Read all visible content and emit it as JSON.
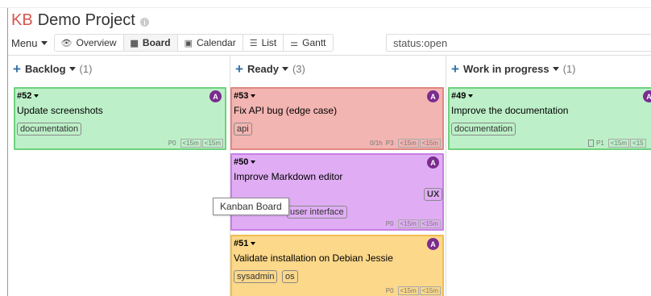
{
  "header": {
    "logo": "KB",
    "project_title": "Demo Project"
  },
  "toolbar": {
    "menu_label": "Menu",
    "views": [
      {
        "label": "Overview",
        "icon": "eye-icon",
        "glyph": "👁"
      },
      {
        "label": "Board",
        "icon": "board-icon",
        "glyph": "▦"
      },
      {
        "label": "Calendar",
        "icon": "calendar-icon",
        "glyph": "▣"
      },
      {
        "label": "List",
        "icon": "list-icon",
        "glyph": "☰"
      },
      {
        "label": "Gantt",
        "icon": "gantt-icon",
        "glyph": "⚌"
      }
    ],
    "active_view": "Board"
  },
  "search": {
    "value": "status:open"
  },
  "columns": [
    {
      "title": "Backlog",
      "count": "(1)",
      "tasks": [
        {
          "id": "#52",
          "title": "Update screenshots",
          "tags": [
            "documentation"
          ],
          "avatar": "A",
          "color": "#bdf0c8",
          "border": "#6fd17e",
          "footer": {
            "time": "",
            "priority": "P0",
            "estimates": [
              "<15m",
              "<15m"
            ]
          }
        }
      ]
    },
    {
      "title": "Ready",
      "count": "(3)",
      "tasks": [
        {
          "id": "#53",
          "title": "Fix API bug (edge case)",
          "tags": [
            "api"
          ],
          "avatar": "A",
          "color": "#f2b5b1",
          "border": "#e08882",
          "footer": {
            "time": "0/1h",
            "priority": "P3",
            "estimates": [
              "<15m",
              "<15m"
            ]
          }
        },
        {
          "id": "#50",
          "title": "Improve Markdown editor",
          "tags": [
            "UX",
            "user interface"
          ],
          "avatar": "A",
          "color": "#e0adf4",
          "border": "#c77ee6",
          "footer": {
            "time": "",
            "priority": "P0",
            "estimates": [
              "<15m",
              "<15m"
            ]
          }
        },
        {
          "id": "#51",
          "title": "Validate installation on Debian Jessie",
          "tags": [
            "sysadmin",
            "os"
          ],
          "avatar": "A",
          "color": "#fbd88a",
          "border": "#f0bd50",
          "footer": {
            "time": "",
            "priority": "P0",
            "estimates": [
              "<15m",
              "<15m"
            ]
          }
        }
      ]
    },
    {
      "title": "Work in progress",
      "count": "(1)",
      "tasks": [
        {
          "id": "#49",
          "title": "Improve the documentation",
          "tags": [
            "documentation"
          ],
          "avatar": "A",
          "color": "#bdf0c8",
          "border": "#6fd17e",
          "footer": {
            "time": "",
            "priority": "P1",
            "estimates": [
              "<15m",
              "<15"
            ]
          }
        }
      ]
    }
  ],
  "tooltip": "Kanban Board"
}
